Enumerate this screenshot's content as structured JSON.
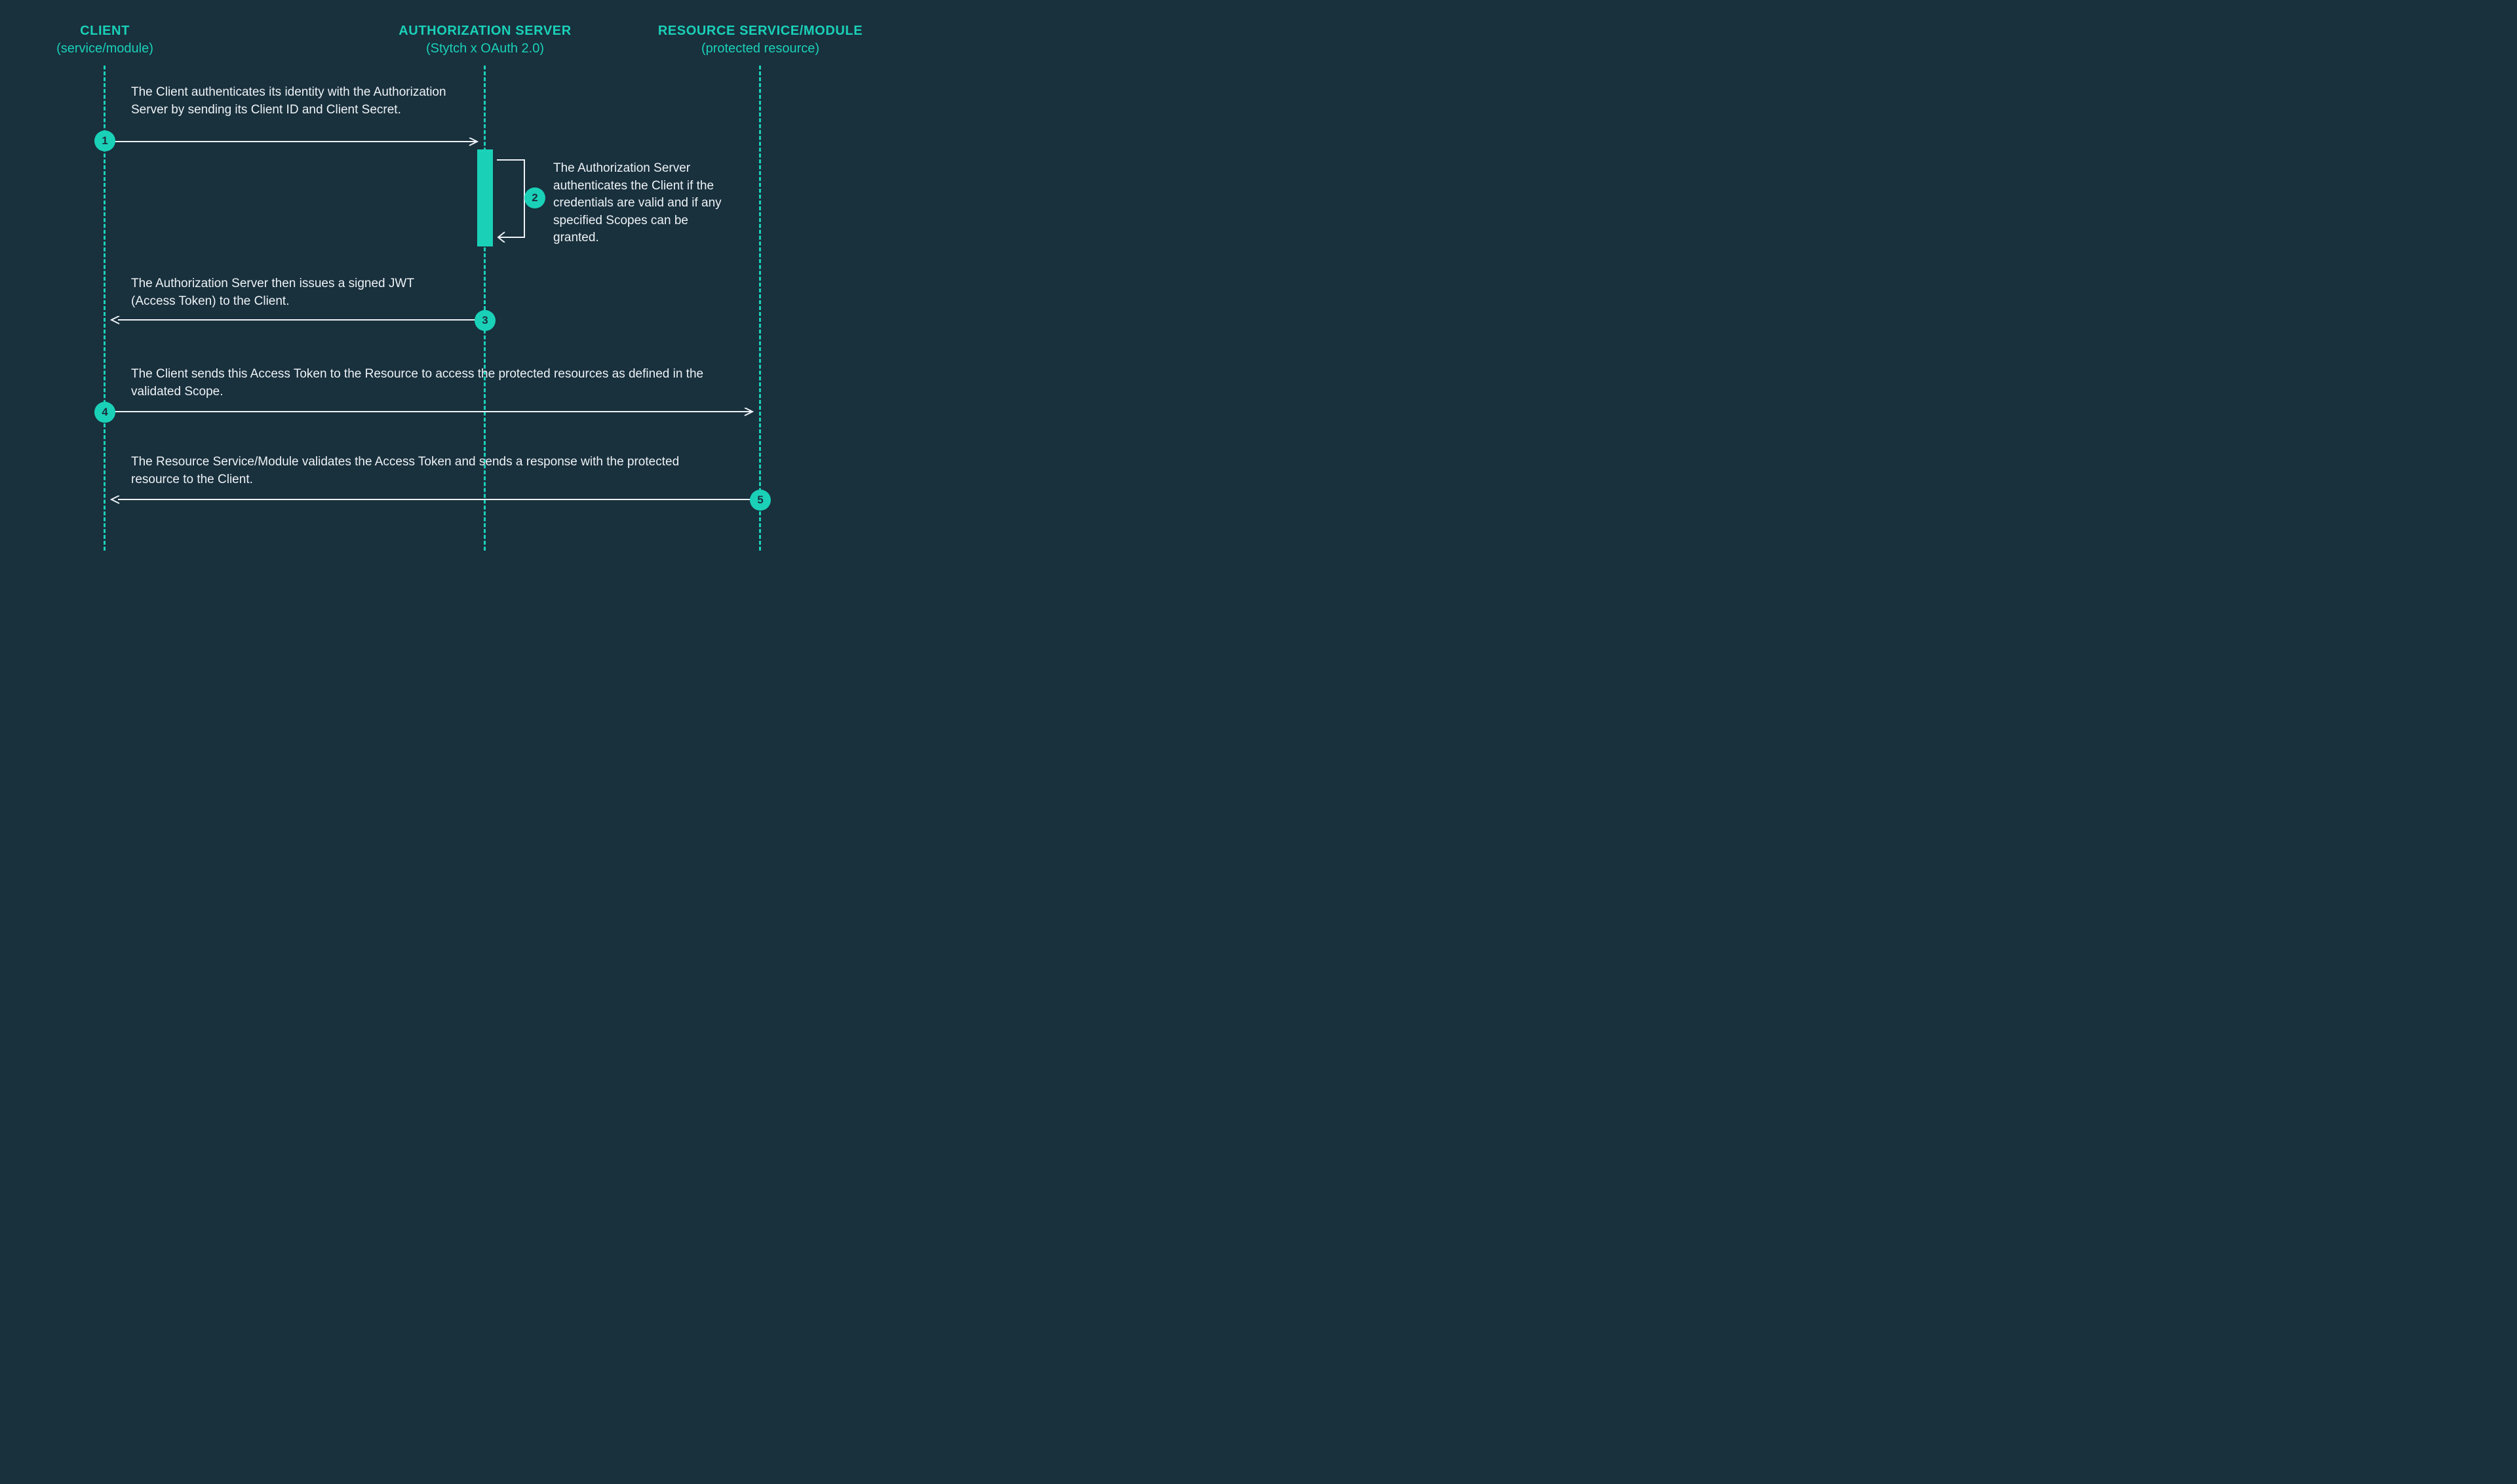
{
  "lanes": {
    "client": {
      "title": "CLIENT",
      "sub": "(service/module)"
    },
    "auth": {
      "title": "AUTHORIZATION SERVER",
      "sub": "(Stytch x OAuth 2.0)"
    },
    "resource": {
      "title": "RESOURCE SERVICE/MODULE",
      "sub": "(protected resource)"
    }
  },
  "steps": {
    "s1": {
      "num": "1",
      "text": "The Client authenticates its identity with the Authorization Server by sending its Client ID and Client Secret."
    },
    "s2": {
      "num": "2",
      "text": "The Authorization Server authenticates the Client if the credentials are valid and if any specified Scopes can be granted."
    },
    "s3": {
      "num": "3",
      "text": "The Authorization Server then issues a signed JWT (Access Token) to the Client."
    },
    "s4": {
      "num": "4",
      "text": "The Client sends this Access Token to the Resource to access the protected resources as defined in the validated Scope."
    },
    "s5": {
      "num": "5",
      "text": "The Resource Service/Module validates the Access Token and sends a response with the protected resource to the Client."
    }
  }
}
